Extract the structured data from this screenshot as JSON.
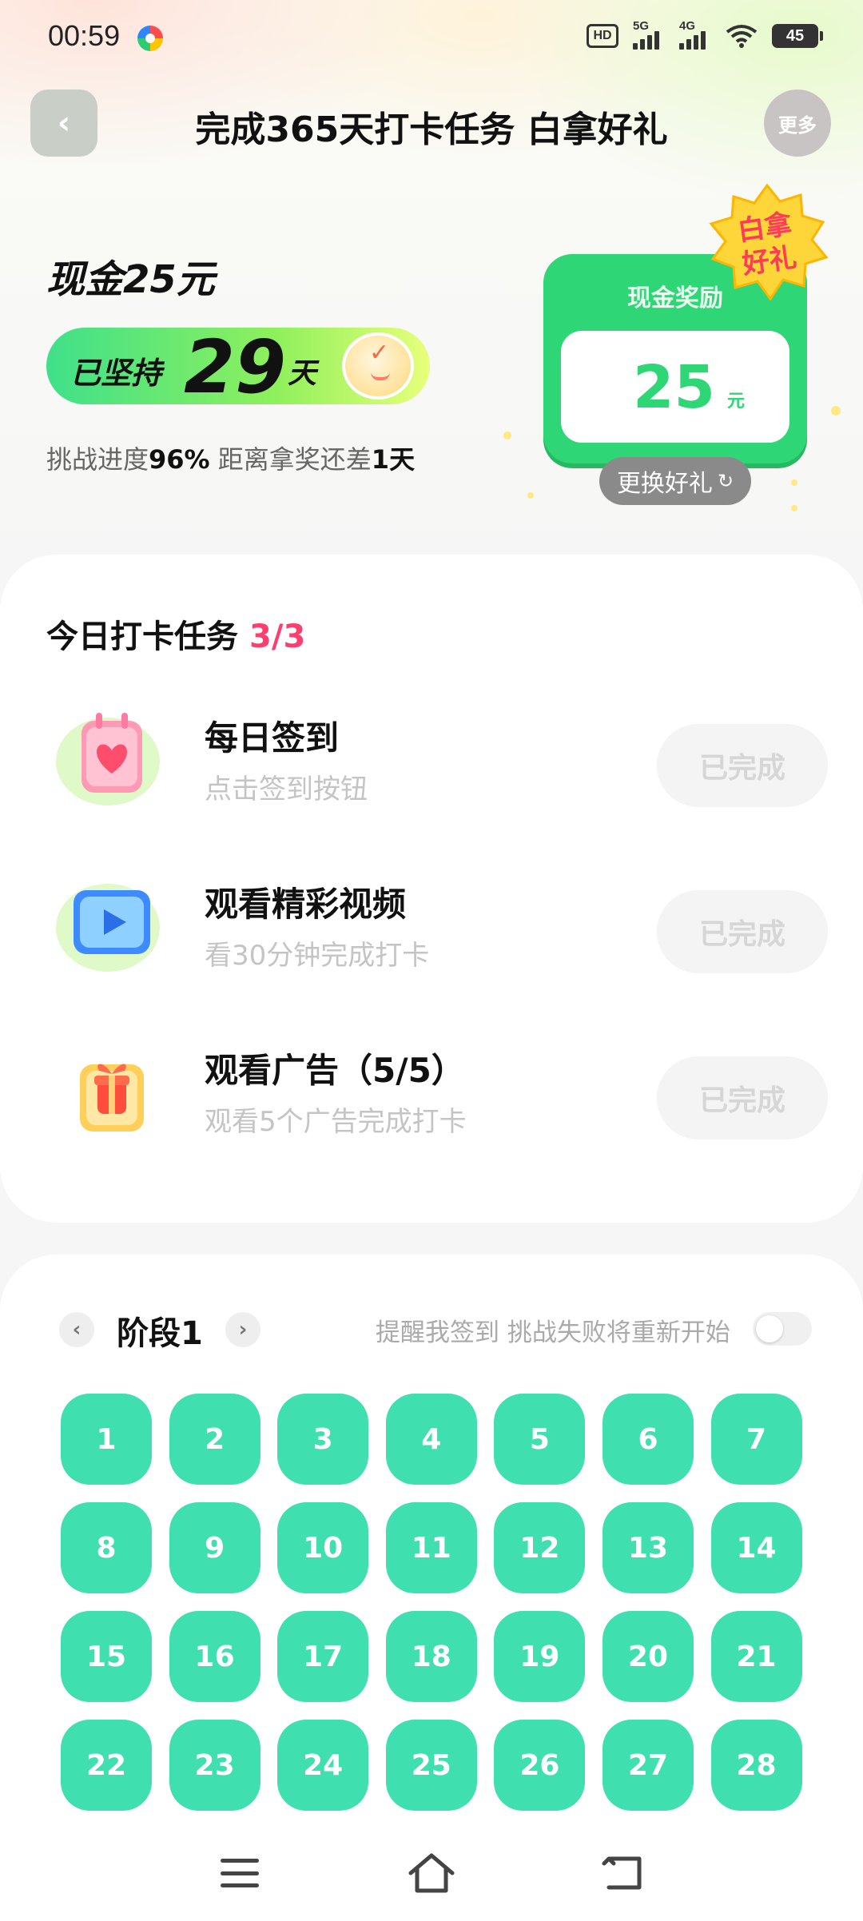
{
  "status_bar": {
    "time": "00:59",
    "hd_label": "HD",
    "signal_1_label": "5G",
    "signal_2_label": "4G",
    "battery": "45"
  },
  "header": {
    "back_icon": "‹",
    "title": "完成365天打卡任务 白拿好礼",
    "more_label": "更多"
  },
  "summary": {
    "reward_title": "现金25元",
    "streak_label": "已坚持",
    "streak_days": "29",
    "streak_unit": "天",
    "progress_prefix": "挑战进度",
    "progress_percent": "96%",
    "progress_middle": " 距离拿奖还差",
    "remaining_days": "1天"
  },
  "reward_card": {
    "label": "现金奖励",
    "amount": "25",
    "unit": "元",
    "stamp_line1": "白拿",
    "stamp_line2": "好礼",
    "change_gift_label": "更换好礼",
    "refresh_icon": "↻"
  },
  "tasks": {
    "header": "今日打卡任务",
    "count": "3/3",
    "items": [
      {
        "name": "每日签到",
        "desc": "点击签到按钮",
        "button": "已完成",
        "icon": "calendar-heart-icon"
      },
      {
        "name": "观看精彩视频",
        "desc": "看30分钟完成打卡",
        "button": "已完成",
        "icon": "video-play-icon"
      },
      {
        "name": "观看广告（5/5）",
        "desc": "观看5个广告完成打卡",
        "button": "已完成",
        "icon": "gift-box-icon"
      }
    ]
  },
  "calendar": {
    "prev_icon": "‹",
    "next_icon": "›",
    "stage_title": "阶段1",
    "remind_text": "提醒我签到 挑战失败将重新开始",
    "remind_enabled": false,
    "days": [
      "1",
      "2",
      "3",
      "4",
      "5",
      "6",
      "7",
      "8",
      "9",
      "10",
      "11",
      "12",
      "13",
      "14",
      "15",
      "16",
      "17",
      "18",
      "19",
      "20",
      "21",
      "22",
      "23",
      "24",
      "25",
      "26",
      "27",
      "28"
    ]
  },
  "colors": {
    "accent_green": "#2fd676",
    "day_teal": "#3fdfb0",
    "count_pink": "#ff3d6e"
  }
}
